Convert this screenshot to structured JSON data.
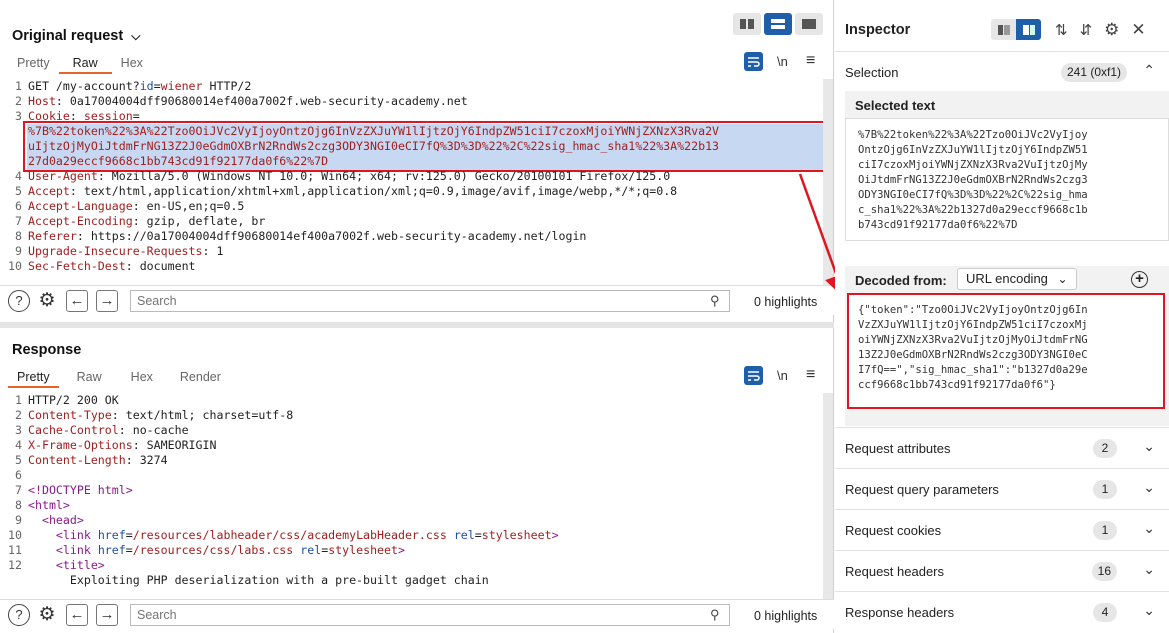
{
  "request": {
    "title": "Original request",
    "tabs": [
      "Pretty",
      "Raw",
      "Hex"
    ],
    "lines": [
      {
        "n": "1",
        "parts": [
          [
            "",
            "GET /my-account?"
          ],
          [
            "attr",
            "id"
          ],
          [
            "",
            "="
          ],
          [
            "k",
            "wiener"
          ],
          [
            "",
            " HTTP/2"
          ]
        ]
      },
      {
        "n": "2",
        "parts": [
          [
            "k",
            "Host"
          ],
          [
            "",
            ": 0a17004004dff90680014ef400a7002f.web-security-academy.net"
          ]
        ]
      },
      {
        "n": "3",
        "parts": [
          [
            "k",
            "Cookie"
          ],
          [
            "",
            ": "
          ],
          [
            "k",
            "session"
          ],
          [
            "",
            "="
          ]
        ]
      },
      {
        "n": "",
        "parts": [
          [
            "k",
            "%7B%22token%22%3A%22Tzo0OiJVc2VyIjoyOntzOjg6InVzZXJuYW1lIjtzOjY6IndpZW51ciI7czoxMjoiYWNjZXNzX3Rva2V"
          ]
        ]
      },
      {
        "n": "",
        "parts": [
          [
            "k",
            "uIjtzOjMyOiJtdmFrNG13Z2J0eGdmOXBrN2RndWs2czg3ODY3NGI0eCI7fQ%3D%3D%22%2C%22sig_hmac_sha1%22%3A%22b13"
          ]
        ]
      },
      {
        "n": "",
        "parts": [
          [
            "k",
            "27d0a29eccf9668c1bb743cd91f92177da0f6%22%7D"
          ]
        ]
      },
      {
        "n": "4",
        "parts": [
          [
            "k",
            "User-Agent"
          ],
          [
            "",
            ": Mozilla/5.0 (Windows NT 10.0; Win64; x64; rv:125.0) Gecko/20100101 Firefox/125.0"
          ]
        ]
      },
      {
        "n": "5",
        "parts": [
          [
            "k",
            "Accept"
          ],
          [
            "",
            ": text/html,application/xhtml+xml,application/xml;q=0.9,image/avif,image/webp,*/*;q=0.8"
          ]
        ]
      },
      {
        "n": "6",
        "parts": [
          [
            "k",
            "Accept-Language"
          ],
          [
            "",
            ": en-US,en;q=0.5"
          ]
        ]
      },
      {
        "n": "7",
        "parts": [
          [
            "k",
            "Accept-Encoding"
          ],
          [
            "",
            ": gzip, deflate, br"
          ]
        ]
      },
      {
        "n": "8",
        "parts": [
          [
            "k",
            "Referer"
          ],
          [
            "",
            ": https://0a17004004dff90680014ef400a7002f.web-security-academy.net/login"
          ]
        ]
      },
      {
        "n": "9",
        "parts": [
          [
            "k",
            "Upgrade-Insecure-Requests"
          ],
          [
            "",
            ": 1"
          ]
        ]
      },
      {
        "n": "10",
        "parts": [
          [
            "k",
            "Sec-Fetch-Dest"
          ],
          [
            "",
            ": document"
          ]
        ]
      }
    ]
  },
  "response": {
    "title": "Response",
    "tabs": [
      "Pretty",
      "Raw",
      "Hex",
      "Render"
    ],
    "lines": [
      {
        "n": "1",
        "parts": [
          [
            "",
            "HTTP/2 200 OK"
          ]
        ]
      },
      {
        "n": "2",
        "parts": [
          [
            "k",
            "Content-Type"
          ],
          [
            "",
            ": text/html; charset=utf-8"
          ]
        ]
      },
      {
        "n": "3",
        "parts": [
          [
            "k",
            "Cache-Control"
          ],
          [
            "",
            ": no-cache"
          ]
        ]
      },
      {
        "n": "4",
        "parts": [
          [
            "k",
            "X-Frame-Options"
          ],
          [
            "",
            ": SAMEORIGIN"
          ]
        ]
      },
      {
        "n": "5",
        "parts": [
          [
            "k",
            "Content-Length"
          ],
          [
            "",
            ": 3274"
          ]
        ]
      },
      {
        "n": "6",
        "parts": [
          [
            "",
            ""
          ]
        ]
      },
      {
        "n": "7",
        "parts": [
          [
            "tag",
            "<!DOCTYPE html>"
          ]
        ]
      },
      {
        "n": "8",
        "parts": [
          [
            "tag",
            "<html>"
          ]
        ]
      },
      {
        "n": "9",
        "parts": [
          [
            "",
            "  "
          ],
          [
            "tag",
            "<head>"
          ]
        ]
      },
      {
        "n": "10",
        "parts": [
          [
            "",
            "    "
          ],
          [
            "tag",
            "<link "
          ],
          [
            "attr",
            "href"
          ],
          [
            "",
            "="
          ],
          [
            "k",
            "/resources/labheader/css/academyLabHeader.css"
          ],
          [
            "",
            " "
          ],
          [
            "attr",
            "rel"
          ],
          [
            "",
            "="
          ],
          [
            "k",
            "stylesheet"
          ],
          [
            "tag",
            ">"
          ]
        ]
      },
      {
        "n": "11",
        "parts": [
          [
            "",
            "    "
          ],
          [
            "tag",
            "<link "
          ],
          [
            "attr",
            "href"
          ],
          [
            "",
            "="
          ],
          [
            "k",
            "/resources/css/labs.css"
          ],
          [
            "",
            " "
          ],
          [
            "attr",
            "rel"
          ],
          [
            "",
            "="
          ],
          [
            "k",
            "stylesheet"
          ],
          [
            "tag",
            ">"
          ]
        ]
      },
      {
        "n": "12",
        "parts": [
          [
            "",
            "    "
          ],
          [
            "tag",
            "<title>"
          ]
        ]
      },
      {
        "n": "",
        "parts": [
          [
            "",
            "      Exploiting PHP deserialization with a pre-built gadget chain"
          ]
        ]
      }
    ]
  },
  "search": {
    "placeholder": "Search",
    "highlights": "0 highlights"
  },
  "toolbar": {
    "wrap_label": "\\n",
    "menu_label": "≡"
  },
  "inspector": {
    "title": "Inspector",
    "selection_label": "Selection",
    "selection_count": "241 (0xf1)",
    "selected_text_label": "Selected text",
    "selected_text": "%7B%22token%22%3A%22Tzo0OiJVc2VyIjoy\nOntzOjg6InVzZXJuYW1lIjtzOjY6IndpZW51\nciI7czoxMjoiYWNjZXNzX3Rva2VuIjtzOjMy\nOiJtdmFrNG13Z2J0eGdmOXBrN2RndWs2czg3\nODY3NGI0eCI7fQ%3D%3D%22%2C%22sig_hma\nc_sha1%22%3A%22b1327d0a29eccf9668c1b\nb743cd91f92177da0f6%22%7D",
    "decoded_from_label": "Decoded from:",
    "decoded_encoding": "URL encoding",
    "decoded_text": "{\"token\":\"Tzo0OiJVc2VyIjoyOntzOjg6In\nVzZXJuYW1lIjtzOjY6IndpZW51ciI7czoxMj\noiYWNjZXNzX3Rva2VuIjtzOjMyOiJtdmFrNG\n13Z2J0eGdmOXBrN2RndWs2czg3ODY3NGI0eC\nI7fQ==\",\"sig_hmac_sha1\":\"b1327d0a29e\nccf9668c1bb743cd91f92177da0f6\"}",
    "rows": [
      {
        "label": "Request attributes",
        "count": "2"
      },
      {
        "label": "Request query parameters",
        "count": "1"
      },
      {
        "label": "Request cookies",
        "count": "1"
      },
      {
        "label": "Request headers",
        "count": "16"
      },
      {
        "label": "Response headers",
        "count": "4"
      }
    ]
  },
  "colors": {
    "accent": "#e8632c",
    "highlight_red": "#e0151f",
    "selection": "#c6d8f2",
    "button_blue": "#1f5ea8"
  }
}
